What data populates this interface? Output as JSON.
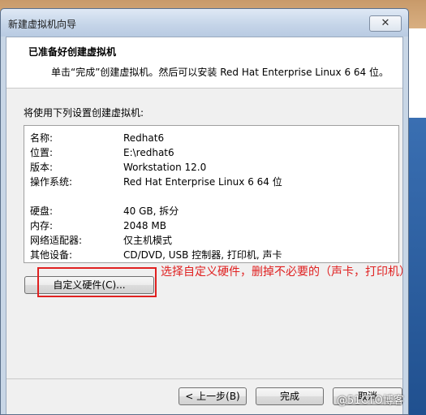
{
  "window": {
    "title": "新建虚拟机向导",
    "close_glyph": "✕"
  },
  "header": {
    "title": "已准备好创建虚拟机",
    "subtitle": "单击“完成”创建虚拟机。然后可以安装 Red Hat Enterprise Linux 6 64 位。"
  },
  "summary": {
    "label": "将使用下列设置创建虚拟机:",
    "rows": [
      {
        "key": "名称:",
        "value": "Redhat6"
      },
      {
        "key": "位置:",
        "value": "E:\\redhat6"
      },
      {
        "key": "版本:",
        "value": "Workstation 12.0"
      },
      {
        "key": "操作系统:",
        "value": "Red Hat Enterprise Linux 6 64 位"
      },
      {
        "key": "硬盘:",
        "value": "40 GB, 拆分"
      },
      {
        "key": "内存:",
        "value": "2048 MB"
      },
      {
        "key": "网络适配器:",
        "value": "仅主机模式"
      },
      {
        "key": "其他设备:",
        "value": "CD/DVD, USB 控制器, 打印机, 声卡"
      }
    ]
  },
  "buttons": {
    "customize": "自定义硬件(C)...",
    "back": "< 上一步(B)",
    "finish": "完成",
    "cancel": "取消"
  },
  "annotation": "选择自定义硬件，删掉不必要的（声卡，打印机）",
  "watermark": "@51CTO博客",
  "colors": {
    "annotation": "#e02020",
    "titlebar": "#c4d4e8"
  }
}
